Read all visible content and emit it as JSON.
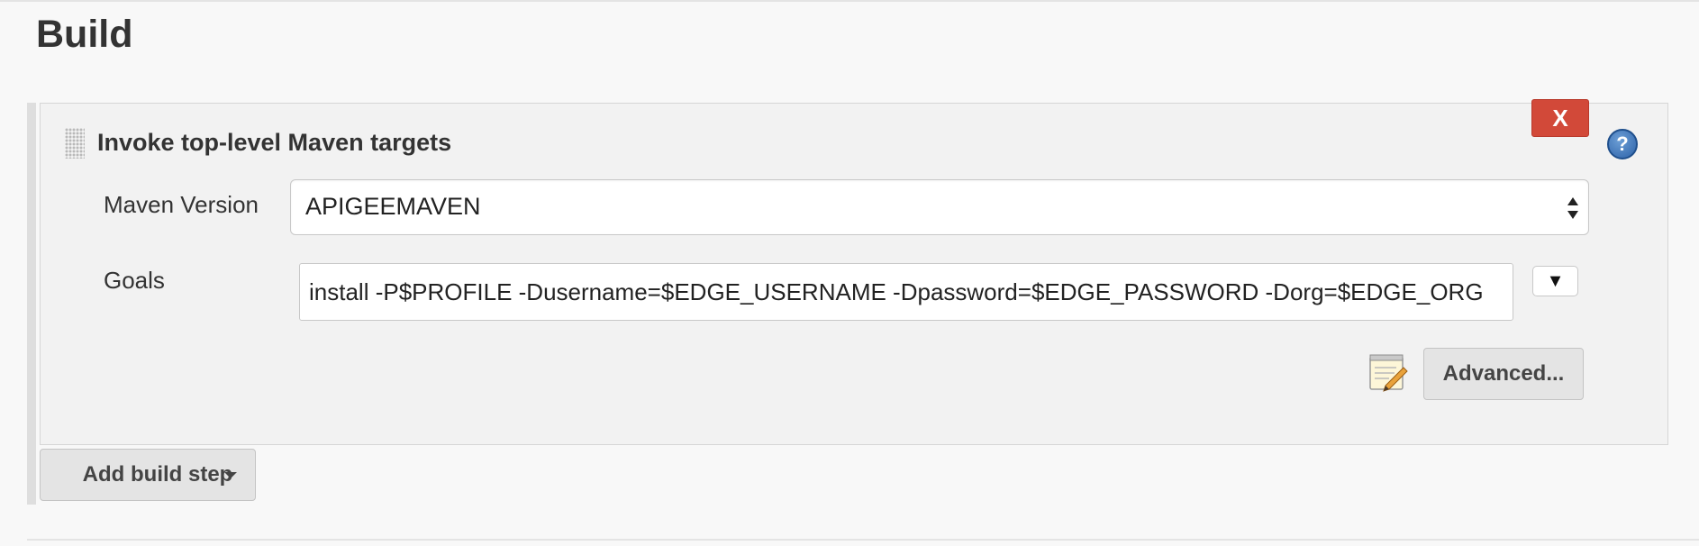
{
  "section": {
    "title": "Build"
  },
  "build_step": {
    "title": "Invoke top-level Maven targets",
    "delete_label": "X",
    "help_label": "?",
    "maven_version": {
      "label": "Maven Version",
      "selected": "APIGEEMAVEN"
    },
    "goals": {
      "label": "Goals",
      "value": "install -P$PROFILE -Dusername=$EDGE_USERNAME -Dpassword=$EDGE_PASSWORD -Dorg=$EDGE_ORG"
    },
    "expand_label": "▼",
    "advanced_label": "Advanced..."
  },
  "add_build_step": {
    "label": "Add build step"
  },
  "colors": {
    "delete": "#d24939",
    "help": "#2d62a8",
    "panel": "#f2f2f2"
  },
  "icons": {
    "drag": "drag-handle-icon",
    "help": "help-icon",
    "notepad": "notepad-icon",
    "caret": "caret-down-icon"
  }
}
